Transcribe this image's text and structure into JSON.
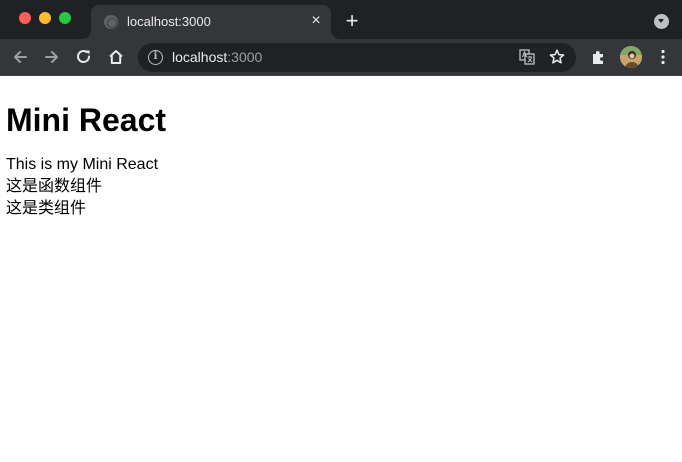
{
  "browser": {
    "tab": {
      "title": "localhost:3000",
      "favicon": "globe-icon"
    },
    "close_icon": "×",
    "new_tab_icon": "+",
    "address_bar": {
      "host": "localhost",
      "port": ":3000"
    },
    "colors": {
      "frame": "#202124",
      "toolbar": "#35363a",
      "close": "#ff5f57",
      "minimize": "#febc2e",
      "maximize": "#28c840"
    }
  },
  "page": {
    "heading": "Mini React",
    "lines": [
      "This is my Mini React",
      "这是函数组件",
      "这是类组件"
    ]
  }
}
